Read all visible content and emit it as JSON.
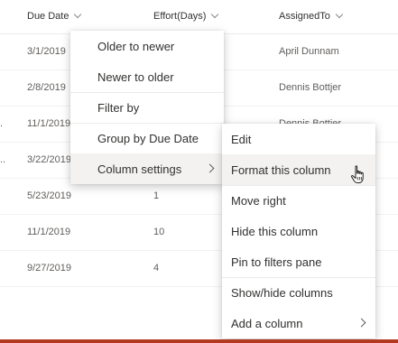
{
  "columns": {
    "due_date": "Due Date",
    "effort": "Effort(Days)",
    "assigned_to": "AssignedTo"
  },
  "rows": [
    {
      "due_date": "3/1/2019",
      "effort": "",
      "assigned_to": "April Dunnam"
    },
    {
      "due_date": "2/8/2019",
      "effort": "",
      "assigned_to": "Dennis Bottjer"
    },
    {
      "due_date": "11/1/2019",
      "effort": "",
      "assigned_to": "Dennis Bottjer"
    },
    {
      "due_date": "3/22/2019",
      "effort": "",
      "assigned_to": ""
    },
    {
      "due_date": "5/23/2019",
      "effort": "1",
      "assigned_to": ""
    },
    {
      "due_date": "11/1/2019",
      "effort": "10",
      "assigned_to": ""
    },
    {
      "due_date": "9/27/2019",
      "effort": "4",
      "assigned_to": ""
    }
  ],
  "row_markers": [
    ".",
    ".."
  ],
  "column_menu": {
    "items": [
      "Older to newer",
      "Newer to older",
      "Filter by",
      "Group by Due Date",
      "Column settings"
    ]
  },
  "settings_submenu": {
    "items": [
      "Edit",
      "Format this column",
      "Move right",
      "Hide this column",
      "Pin to filters pane",
      "Show/hide columns",
      "Add a column"
    ]
  },
  "colors": {
    "accent_bar": "#b33a1e",
    "hover_background": "#f3f2f1"
  },
  "icons": {
    "column_dropdown": "chevron-down-icon",
    "submenu_arrow": "chevron-right-icon",
    "cursor": "hand-pointer-icon"
  }
}
